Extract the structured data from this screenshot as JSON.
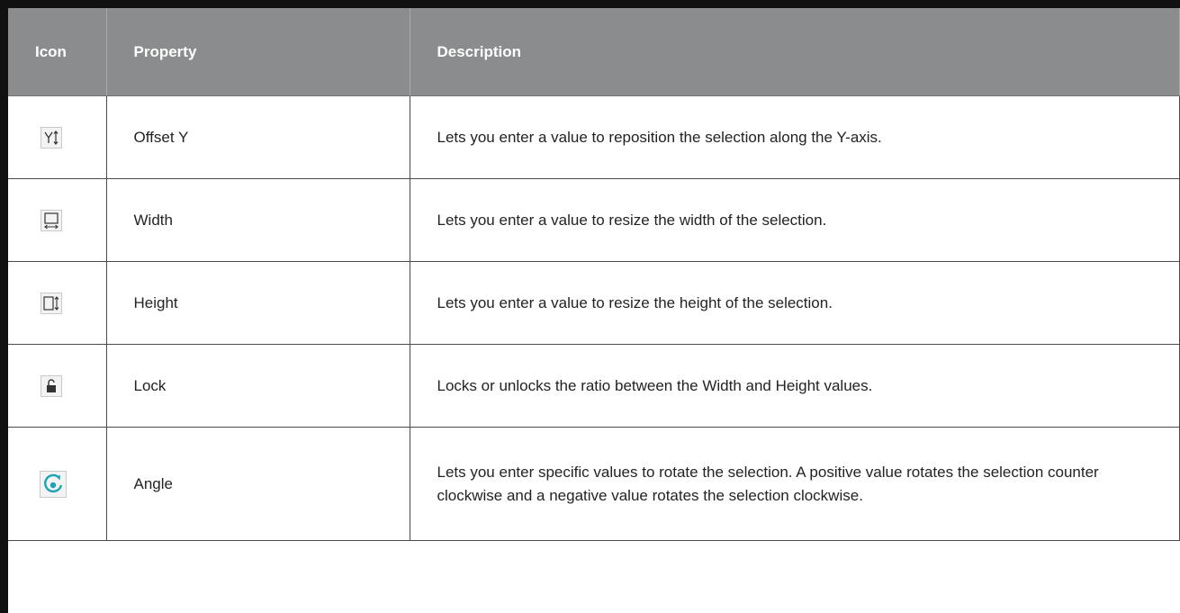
{
  "table": {
    "headers": {
      "icon": "Icon",
      "property": "Property",
      "description": "Description"
    },
    "rows": [
      {
        "icon": "offset-y-icon",
        "property": "Offset Y",
        "description": "Lets you enter a value to reposition the selection along the Y-axis."
      },
      {
        "icon": "width-icon",
        "property": "Width",
        "description": "Lets you enter a value to resize the width of the selection."
      },
      {
        "icon": "height-icon",
        "property": "Height",
        "description": "Lets you enter a value to resize the height of the selection."
      },
      {
        "icon": "lock-icon",
        "property": "Lock",
        "description": "Locks or unlocks the ratio between the Width and Height values."
      },
      {
        "icon": "angle-rotate-icon",
        "property": "Angle",
        "description": "Lets you enter specific values to rotate the selection. A positive value rotates the selection counter clockwise and a negative value rotates the selection clockwise."
      }
    ]
  },
  "colors": {
    "header_bg": "#8a8c8e",
    "header_text": "#ffffff",
    "frame": "#111111",
    "angle_icon_accent": "#1aa3b3"
  }
}
